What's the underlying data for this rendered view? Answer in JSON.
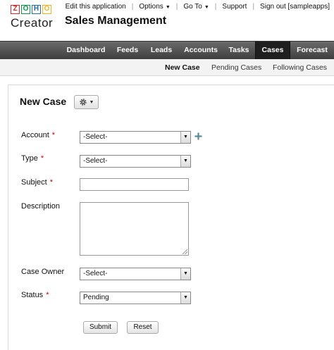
{
  "header": {
    "logo_letters": [
      "Z",
      "O",
      "H",
      "O"
    ],
    "logo_colors": [
      "#e42527",
      "#089949",
      "#226db4",
      "#f9b21d"
    ],
    "logo_text": "Creator",
    "app_title": "Sales Management",
    "links": [
      {
        "label": "Edit this application"
      },
      {
        "label": "Options",
        "caret": "▼"
      },
      {
        "label": "Go To",
        "caret": "▼"
      },
      {
        "label": "Support"
      },
      {
        "label": "Sign out [sampleapps]"
      }
    ],
    "separator": "|"
  },
  "nav": {
    "items": [
      "Dashboard",
      "Feeds",
      "Leads",
      "Accounts",
      "Tasks",
      "Cases",
      "Forecast"
    ],
    "active": "Cases"
  },
  "subnav": {
    "items": [
      "New Case",
      "Pending Cases",
      "Following Cases"
    ],
    "active": "New Case"
  },
  "form": {
    "title": "New Case",
    "gear_icon": "gear-icon",
    "required_mark": "*",
    "fields": {
      "account": {
        "label": "Account",
        "value": "-Select-",
        "required": true
      },
      "type": {
        "label": "Type",
        "value": "-Select-",
        "required": true
      },
      "subject": {
        "label": "Subject",
        "value": "",
        "required": true
      },
      "description": {
        "label": "Description",
        "value": "",
        "required": false
      },
      "case_owner": {
        "label": "Case Owner",
        "value": "-Select-",
        "required": false
      },
      "status": {
        "label": "Status",
        "value": "Pending",
        "required": true
      }
    },
    "submit_label": "Submit",
    "reset_label": "Reset"
  },
  "colors": {
    "nav_bg": "#4f4f4f",
    "nav_active": "#1f1f1f",
    "required": "#cc0000",
    "plus_icon": "#5a8a9a"
  }
}
